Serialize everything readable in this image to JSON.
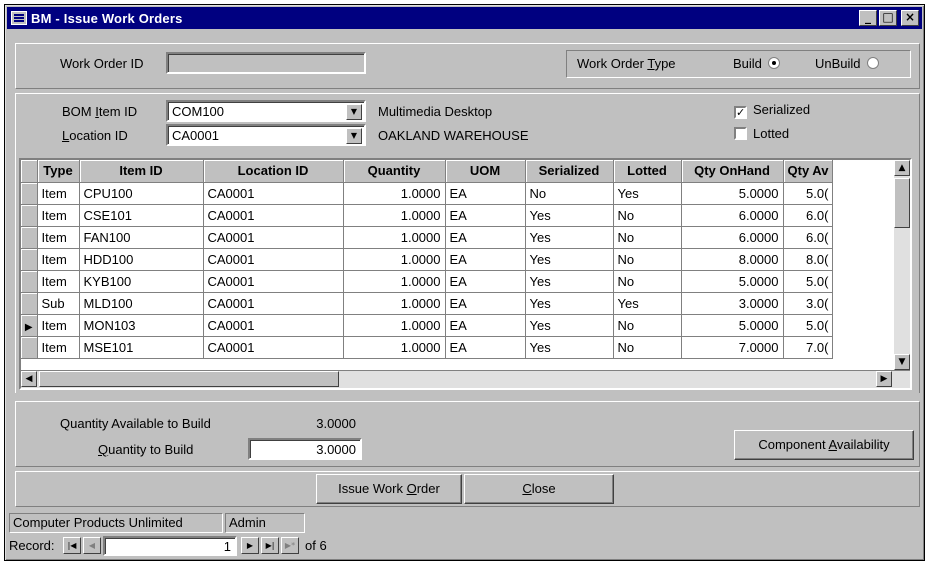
{
  "window": {
    "title": "BM - Issue Work Orders",
    "minimize_glyph": "_",
    "maximize_glyph": "□",
    "close_glyph": "×"
  },
  "header": {
    "work_order_id_label": "Work Order ID",
    "work_order_id_value": "",
    "work_order_type_label_pre": "Work Order ",
    "work_order_type_label_key": "T",
    "work_order_type_label_post": "ype",
    "build_label": "Build",
    "build_selected": true,
    "unbuild_label": "UnBuild",
    "unbuild_selected": false
  },
  "bom": {
    "bom_item_label_pre": "BOM ",
    "bom_item_label_key": "I",
    "bom_item_label_post": "tem ID",
    "bom_item_value": "COM100",
    "bom_item_desc": "Multimedia Desktop",
    "location_label_key": "L",
    "location_label_post": "ocation ID",
    "location_value": "CA0001",
    "location_desc": "OAKLAND WAREHOUSE",
    "serialized_label": "Serialized",
    "serialized_checked": true,
    "lotted_label": "Lotted",
    "lotted_checked": false
  },
  "grid": {
    "columns": [
      "Type",
      "Item ID",
      "Location ID",
      "Quantity",
      "UOM",
      "Serialized",
      "Lotted",
      "Qty OnHand",
      "Qty Av"
    ],
    "current_row_marker": "▶",
    "rows": [
      [
        "Item",
        "CPU100",
        "CA0001",
        "1.0000",
        "EA",
        "No",
        "Yes",
        "5.0000",
        "5.0("
      ],
      [
        "Item",
        "CSE101",
        "CA0001",
        "1.0000",
        "EA",
        "Yes",
        "No",
        "6.0000",
        "6.0("
      ],
      [
        "Item",
        "FAN100",
        "CA0001",
        "1.0000",
        "EA",
        "Yes",
        "No",
        "6.0000",
        "6.0("
      ],
      [
        "Item",
        "HDD100",
        "CA0001",
        "1.0000",
        "EA",
        "Yes",
        "No",
        "8.0000",
        "8.0("
      ],
      [
        "Item",
        "KYB100",
        "CA0001",
        "1.0000",
        "EA",
        "Yes",
        "No",
        "5.0000",
        "5.0("
      ],
      [
        "Sub",
        "MLD100",
        "CA0001",
        "1.0000",
        "EA",
        "Yes",
        "Yes",
        "3.0000",
        "3.0("
      ],
      [
        "Item",
        "MON103",
        "CA0001",
        "1.0000",
        "EA",
        "Yes",
        "No",
        "5.0000",
        "5.0("
      ],
      [
        "Item",
        "MSE101",
        "CA0001",
        "1.0000",
        "EA",
        "Yes",
        "No",
        "7.0000",
        "7.0("
      ]
    ],
    "current_row_index": 6
  },
  "build": {
    "qty_available_label": "Quantity Available to Build",
    "qty_available_value": "3.0000",
    "qty_to_build_label_key": "Q",
    "qty_to_build_label_post": "uantity to Build",
    "qty_to_build_value": "3.0000",
    "component_availability_pre": "Component ",
    "component_availability_key": "A",
    "component_availability_post": "vailability"
  },
  "actions": {
    "issue_pre": "Issue Work ",
    "issue_key": "O",
    "issue_post": "rder",
    "close_key": "C",
    "close_post": "lose"
  },
  "status": {
    "company": "Computer Products Unlimited",
    "user": "Admin"
  },
  "record_nav": {
    "label": "Record:",
    "current": "1",
    "of_text": "of 6"
  }
}
